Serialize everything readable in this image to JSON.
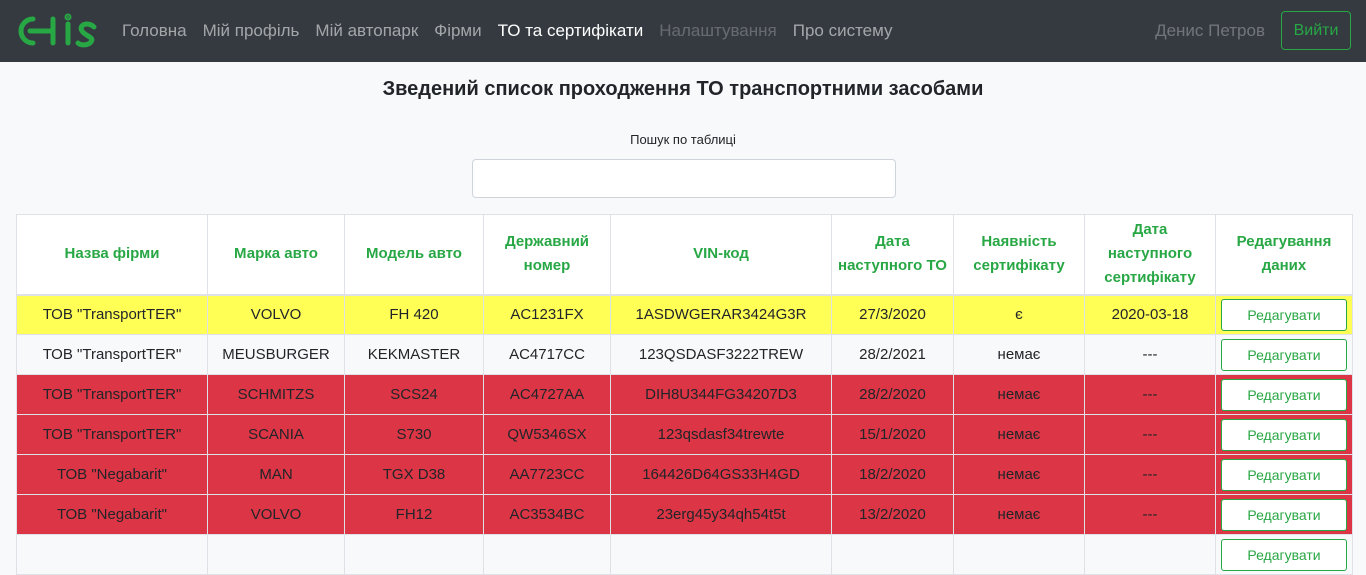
{
  "navbar": {
    "links": [
      {
        "label": "Головна",
        "state": "normal"
      },
      {
        "label": "Мій профіль",
        "state": "normal"
      },
      {
        "label": "Мій автопарк",
        "state": "normal"
      },
      {
        "label": "Фірми",
        "state": "normal"
      },
      {
        "label": "ТО та сертифікати",
        "state": "active"
      },
      {
        "label": "Налаштування",
        "state": "disabled"
      },
      {
        "label": "Про систему",
        "state": "normal"
      }
    ],
    "user_name": "Денис Петров",
    "logout_label": "Вийти"
  },
  "page": {
    "title": "Зведений список проходження ТО транспортними засобами",
    "search_label": "Пошук по таблиці",
    "search_value": ""
  },
  "table": {
    "headers": [
      "Назва фірми",
      "Марка авто",
      "Модель авто",
      "Державний номер",
      "VIN-код",
      "Дата наступного ТО",
      "Наявність сертифікату",
      "Дата наступного сертифікату",
      "Редагування даних"
    ],
    "edit_label": "Редагувати",
    "rows": [
      {
        "status": "yellow",
        "cells": [
          "ТОВ \"TransportTER\"",
          "VOLVO",
          "FH 420",
          "AC1231FX",
          "1ASDWGERAR3424G3R",
          "27/3/2020",
          "є",
          "2020-03-18"
        ]
      },
      {
        "status": "white",
        "cells": [
          "ТОВ \"TransportTER\"",
          "MEUSBURGER",
          "KEKMASTER",
          "AC4717CC",
          "123QSDASF3222TREW",
          "28/2/2021",
          "немає",
          "---"
        ]
      },
      {
        "status": "red",
        "cells": [
          "ТОВ \"TransportTER\"",
          "SCHMITZS",
          "SCS24",
          "AC4727AA",
          "DIH8U344FG34207D3",
          "28/2/2020",
          "немає",
          "---"
        ]
      },
      {
        "status": "red",
        "cells": [
          "ТОВ \"TransportTER\"",
          "SCANIA",
          "S730",
          "QW5346SX",
          "123qsdasf34trewte",
          "15/1/2020",
          "немає",
          "---"
        ]
      },
      {
        "status": "red",
        "cells": [
          "ТОВ \"Negabarit\"",
          "MAN",
          "TGX D38",
          "AA7723CC",
          "164426D64GS33H4GD",
          "18/2/2020",
          "немає",
          "---"
        ]
      },
      {
        "status": "red",
        "cells": [
          "ТОВ \"Negabarit\"",
          "VOLVO",
          "FH12",
          "AC3534BC",
          "23erg45y34qh54t5t",
          "13/2/2020",
          "немає",
          "---"
        ]
      },
      {
        "status": "white",
        "cells": [
          "",
          "",
          "",
          "",
          "",
          "",
          "",
          ""
        ]
      }
    ]
  },
  "colors": {
    "navbar_bg": "#343a40",
    "accent_green": "#28a745",
    "row_yellow": "#ffff55",
    "row_red": "#dc3545"
  }
}
